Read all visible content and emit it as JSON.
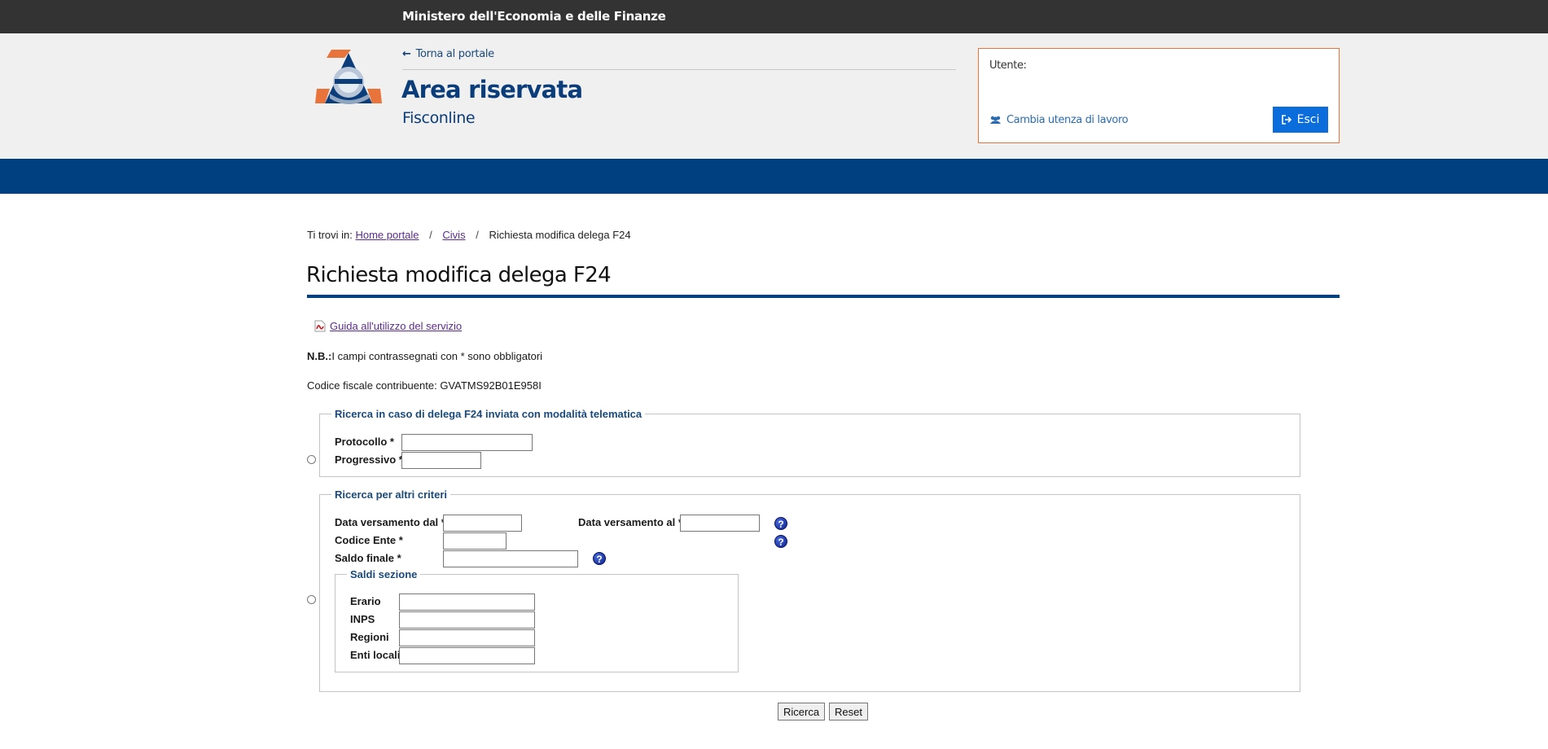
{
  "topbar": {
    "ministry": "Ministero dell'Economia e delle Finanze"
  },
  "header": {
    "back_link": "Torna al portale",
    "title": "Area riservata",
    "subtitle": "Fisconline",
    "user_label": "Utente:",
    "change_user": "Cambia utenza di lavoro",
    "logout": "Esci"
  },
  "breadcrumb": {
    "prefix": "Ti trovi in:",
    "items": [
      "Home portale",
      "Civis",
      "Richiesta modifica delega F24"
    ]
  },
  "page": {
    "title": "Richiesta modifica delega F24",
    "guide_link": "Guida all'utilizzo del servizio",
    "nb_bold": "N.B.:",
    "nb_text": "I campi contrassegnati con * sono obbligatori",
    "codice_fiscale": "Codice fiscale contribuente: GVATMS92B01E958I"
  },
  "search_telematic": {
    "legend": "Ricerca in caso di delega F24 inviata con modalità telematica",
    "protocollo_label": "Protocollo *",
    "progressivo_label": "Progressivo *"
  },
  "search_other": {
    "legend": "Ricerca per altri criteri",
    "data_dal_label": "Data versamento dal *",
    "data_al_label": "Data versamento al *",
    "codice_ente_label": "Codice Ente *",
    "saldo_finale_label": "Saldo finale *",
    "saldi": {
      "legend": "Saldi sezione",
      "erario": "Erario",
      "inps": "INPS",
      "regioni": "Regioni",
      "enti_locali": "Enti locali"
    }
  },
  "buttons": {
    "search": "Ricerca",
    "reset": "Reset"
  },
  "colors": {
    "brand_blue": "#003f80",
    "top_bar": "#333333",
    "accent_orange": "#e8743b",
    "button_blue": "#0a6ddb"
  },
  "icons": {
    "logo": "agenzia-entrate-logo",
    "back": "arrow-left-icon",
    "users": "users-icon",
    "logout": "sign-out-icon",
    "pdf": "pdf-icon",
    "help": "help-icon"
  }
}
